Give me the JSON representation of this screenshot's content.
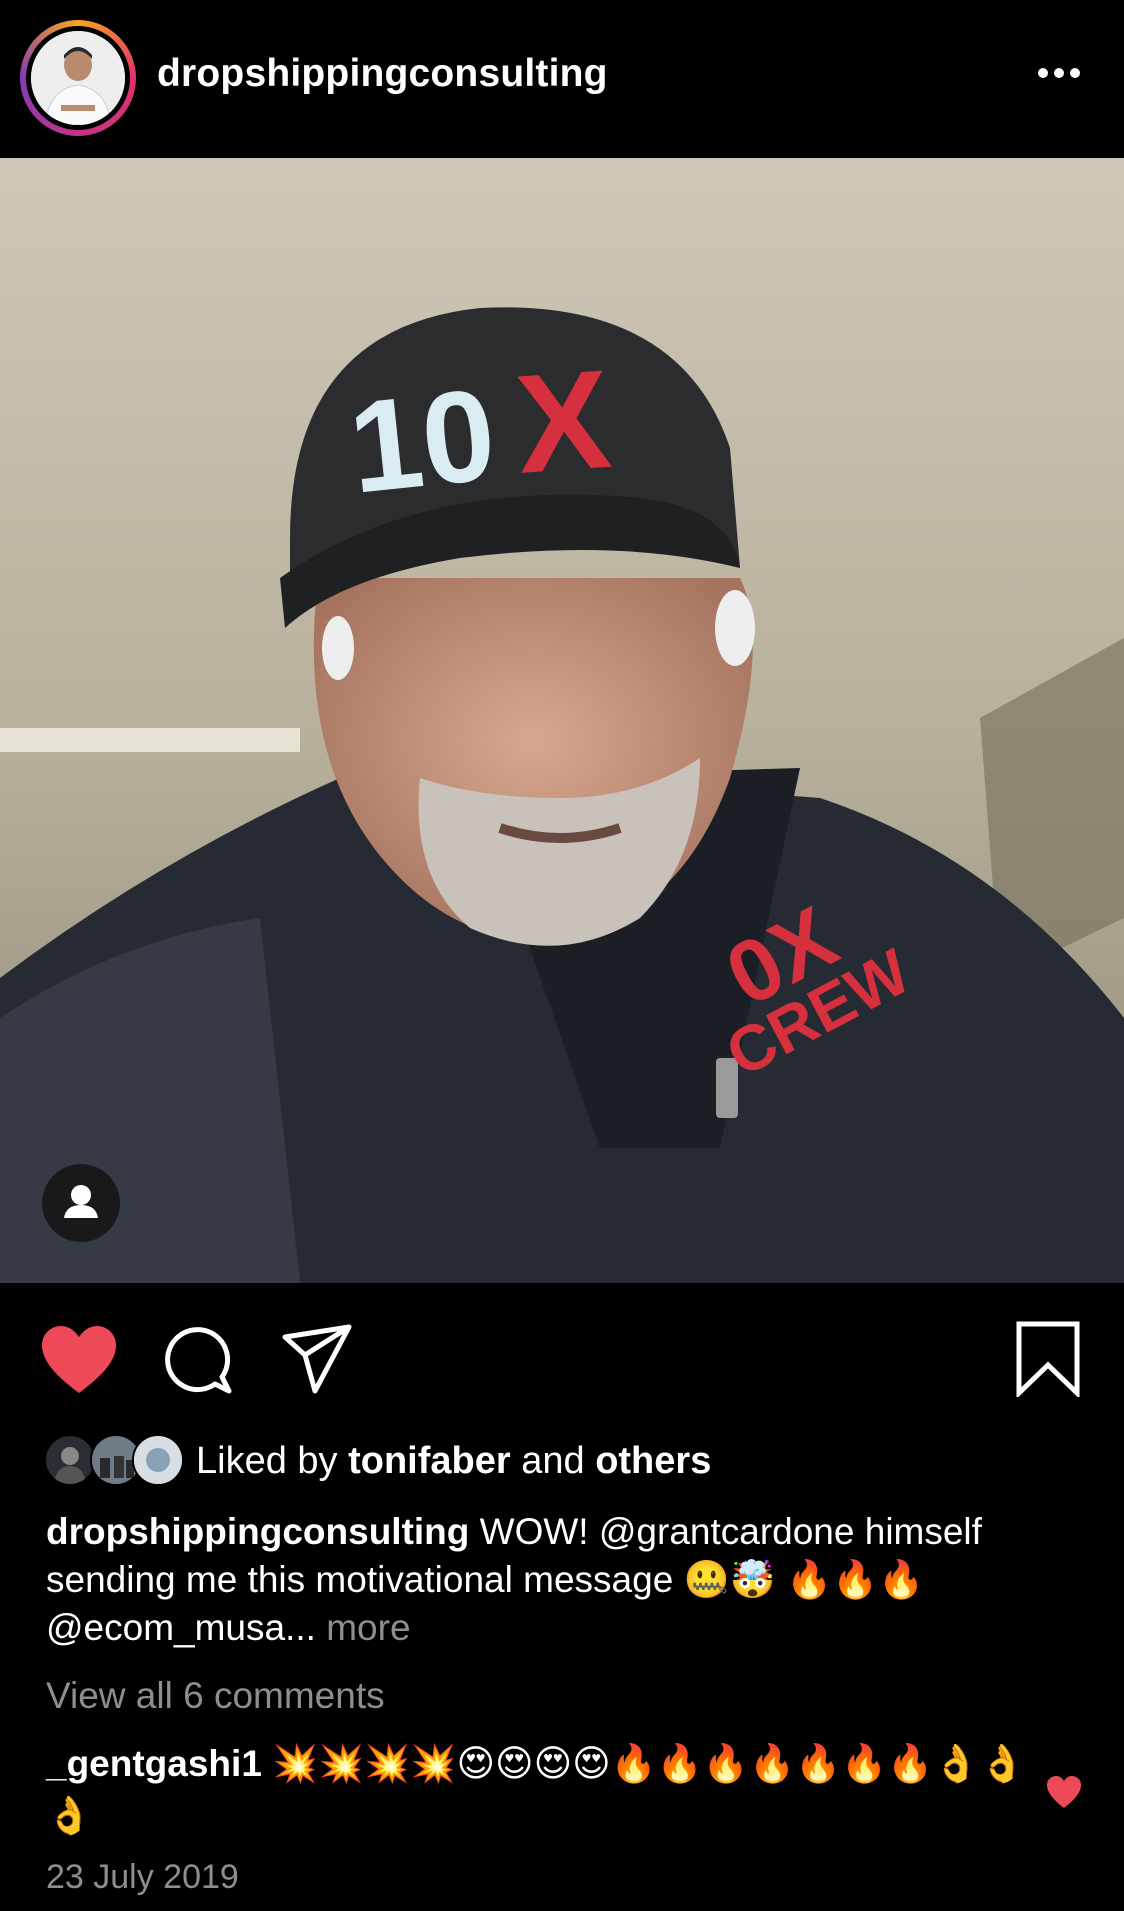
{
  "header": {
    "username": "dropshippingconsulting",
    "more_icon": "more-horizontal-icon"
  },
  "post": {
    "user_tag_icon": "person-icon",
    "cap_text": "10X",
    "jacket_text": "10X CREW"
  },
  "actions": {
    "like_icon": "heart-filled-icon",
    "comment_icon": "comment-bubble-icon",
    "share_icon": "paper-plane-icon",
    "save_icon": "bookmark-icon",
    "like_color": "#ed4956"
  },
  "likes": {
    "prefix": "Liked by ",
    "user": "tonifaber",
    "middle": " and ",
    "others": "others"
  },
  "caption": {
    "user": "dropshippingconsulting",
    "text": " WOW! @grantcardone himself sending me this motivational message 🤐🤯 🔥🔥🔥 @ecom_musa...",
    "more": " more"
  },
  "comments": {
    "view_all": "View all 6 comments",
    "items": [
      {
        "user": "_gentgashi1",
        "text": " 💥💥💥💥😍😍😍😍🔥🔥🔥🔥🔥🔥🔥👌👌👌"
      }
    ]
  },
  "date": "23 July 2019"
}
